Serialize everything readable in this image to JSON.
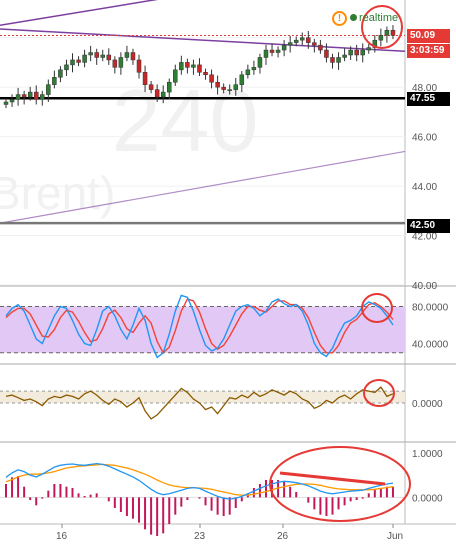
{
  "header": {
    "alert_icon": "exclamation-circle-icon",
    "realtime_label": "realtime"
  },
  "watermark": {
    "line1": "240",
    "line2": "Brent)"
  },
  "price_tags": {
    "last_price": "50.09",
    "countdown": "3:03:59",
    "line_47": "47.55",
    "line_42": "42.50"
  },
  "colors": {
    "up": "#2e7d32",
    "down": "#c62828",
    "trendline": "#7b3fa0",
    "hline": "#000000",
    "hline_gray": "#777777",
    "stoch_fill": "#e2c8f4",
    "stoch_k": "#2196f3",
    "stoch_d": "#f44336",
    "osc": "#8b5a00",
    "osc_fill": "#f3ecdc",
    "macd": "#2196f3",
    "signal": "#ff9800",
    "hist": "#c2185b",
    "annot": "#e53935"
  },
  "chart_data": [
    {
      "type": "candlestick",
      "title": "",
      "ylim": [
        40,
        51.2
      ],
      "y_ticks": [
        "50.00",
        "48.00",
        "46.00",
        "44.00",
        "42.00",
        "40.00"
      ],
      "x_ticks": [
        "16",
        "23",
        "26",
        "Jun"
      ],
      "horizontal_levels": [
        47.55,
        42.5
      ],
      "last_price": 50.09,
      "closes": [
        47.4,
        47.5,
        47.7,
        47.6,
        47.8,
        47.5,
        47.7,
        48.1,
        48.4,
        48.7,
        48.9,
        49.1,
        49.0,
        49.3,
        49.4,
        49.2,
        49.3,
        49.1,
        48.8,
        49.2,
        49.4,
        49.1,
        48.6,
        48.1,
        47.9,
        47.6,
        47.8,
        48.2,
        48.7,
        49.0,
        48.8,
        48.9,
        48.6,
        48.5,
        48.2,
        48.0,
        47.9,
        47.9,
        48.1,
        48.5,
        48.7,
        48.8,
        49.2,
        49.5,
        49.4,
        49.5,
        49.7,
        49.8,
        49.9,
        50.0,
        49.8,
        49.7,
        49.5,
        49.2,
        49.0,
        49.2,
        49.3,
        49.5,
        49.3,
        49.5,
        49.6,
        49.9,
        50.1,
        50.3,
        50.09
      ]
    },
    {
      "type": "line",
      "name_hint": "stochastic",
      "ylim": [
        20,
        100
      ],
      "y_ticks": [
        "80.0000",
        "40.0000"
      ],
      "band": [
        30,
        80
      ],
      "k": [
        70,
        78,
        82,
        75,
        60,
        45,
        40,
        55,
        70,
        80,
        78,
        65,
        50,
        40,
        38,
        55,
        75,
        80,
        70,
        55,
        45,
        60,
        78,
        65,
        40,
        25,
        30,
        50,
        75,
        92,
        90,
        75,
        55,
        38,
        32,
        35,
        45,
        60,
        75,
        80,
        82,
        78,
        70,
        75,
        85,
        88,
        83,
        80,
        82,
        75,
        60,
        40,
        30,
        26,
        35,
        50,
        62,
        65,
        70,
        80,
        85,
        82,
        78,
        70,
        60
      ],
      "d": [
        68,
        74,
        78,
        78,
        72,
        60,
        48,
        47,
        55,
        68,
        76,
        74,
        64,
        52,
        42,
        44,
        56,
        72,
        76,
        68,
        56,
        52,
        62,
        70,
        62,
        42,
        30,
        36,
        54,
        75,
        88,
        86,
        74,
        56,
        40,
        34,
        38,
        48,
        60,
        72,
        80,
        80,
        76,
        74,
        80,
        86,
        86,
        82,
        82,
        78,
        68,
        52,
        38,
        30,
        30,
        38,
        52,
        62,
        66,
        74,
        82,
        84,
        80,
        74,
        66
      ]
    },
    {
      "type": "line",
      "name_hint": "oscillator",
      "ylim": [
        -0.28,
        0.28
      ],
      "y_ticks": [
        "0.0000"
      ],
      "band": [
        0.0,
        0.09
      ],
      "values": [
        0.05,
        0.06,
        0.04,
        0.02,
        0.03,
        0.01,
        -0.02,
        0.03,
        0.05,
        0.04,
        0.06,
        0.05,
        0.03,
        0.07,
        0.09,
        0.06,
        0.02,
        -0.01,
        0.03,
        0.01,
        -0.03,
        0.0,
        0.04,
        -0.06,
        -0.12,
        -0.09,
        -0.04,
        0.01,
        0.06,
        0.11,
        0.08,
        0.03,
        0.0,
        -0.05,
        -0.03,
        -0.08,
        -0.02,
        0.04,
        0.03,
        0.06,
        0.04,
        0.08,
        0.05,
        0.07,
        0.1,
        0.08,
        0.06,
        0.09,
        0.07,
        0.03,
        0.01,
        -0.04,
        -0.02,
        0.02,
        0.0,
        0.04,
        0.06,
        0.03,
        0.07,
        0.1,
        0.09,
        0.08,
        0.12,
        0.05,
        0.07
      ]
    },
    {
      "type": "line",
      "name_hint": "macd",
      "ylim": [
        -0.6,
        1.2
      ],
      "y_ticks": [
        "1.0000",
        "0.0000"
      ],
      "macd": [
        0.45,
        0.55,
        0.62,
        0.58,
        0.5,
        0.46,
        0.52,
        0.6,
        0.68,
        0.72,
        0.74,
        0.75,
        0.73,
        0.72,
        0.74,
        0.76,
        0.74,
        0.7,
        0.64,
        0.58,
        0.52,
        0.46,
        0.38,
        0.28,
        0.18,
        0.1,
        0.06,
        0.08,
        0.12,
        0.16,
        0.2,
        0.22,
        0.2,
        0.14,
        0.08,
        0.02,
        -0.02,
        -0.04,
        -0.02,
        0.02,
        0.08,
        0.14,
        0.2,
        0.26,
        0.3,
        0.34,
        0.36,
        0.35,
        0.33,
        0.3,
        0.26,
        0.2,
        0.14,
        0.1,
        0.08,
        0.1,
        0.12,
        0.14,
        0.15,
        0.16,
        0.2,
        0.24,
        0.27,
        0.3,
        0.32
      ],
      "signal": [
        0.35,
        0.4,
        0.46,
        0.5,
        0.52,
        0.52,
        0.53,
        0.55,
        0.58,
        0.62,
        0.66,
        0.68,
        0.7,
        0.71,
        0.72,
        0.73,
        0.74,
        0.73,
        0.72,
        0.69,
        0.66,
        0.62,
        0.57,
        0.52,
        0.46,
        0.39,
        0.33,
        0.28,
        0.25,
        0.23,
        0.22,
        0.22,
        0.21,
        0.2,
        0.18,
        0.15,
        0.12,
        0.09,
        0.06,
        0.05,
        0.05,
        0.07,
        0.1,
        0.13,
        0.17,
        0.21,
        0.24,
        0.27,
        0.29,
        0.3,
        0.3,
        0.29,
        0.27,
        0.24,
        0.21,
        0.19,
        0.18,
        0.17,
        0.17,
        0.17,
        0.17,
        0.18,
        0.2,
        0.22,
        0.24
      ]
    }
  ]
}
